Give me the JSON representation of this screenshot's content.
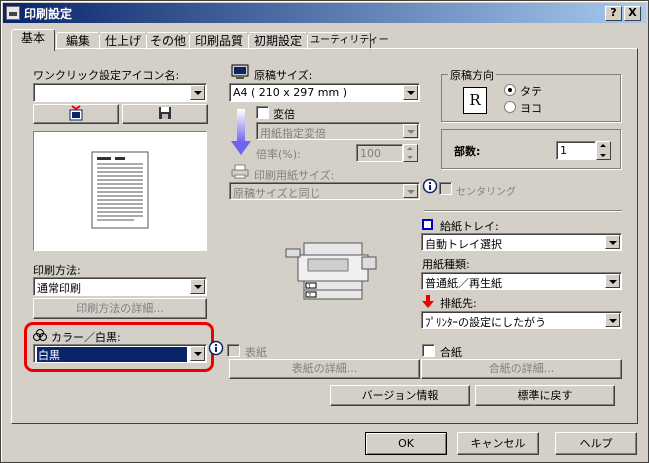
{
  "window": {
    "title": "印刷設定",
    "help_button": "?",
    "close_button": "X"
  },
  "tabs": [
    "基本",
    "編集",
    "仕上げ",
    "その他",
    "印刷品質",
    "初期設定",
    "ユーティリティー"
  ],
  "oneclick": {
    "label": "ワンクリック設定アイコン名:",
    "value": ""
  },
  "print_method": {
    "label": "印刷方法:",
    "value": "通常印刷",
    "details_button": "印刷方法の詳細..."
  },
  "color": {
    "label": "カラー／白黒:",
    "value": "白黒"
  },
  "original_size": {
    "label": "原稿サイズ:",
    "value": "A4 ( 210 x 297 mm )"
  },
  "scale": {
    "checkbox_label": "変倍",
    "paper_label": "用紙指定変倍",
    "ratio_label": "倍率(%):",
    "ratio_value": "100"
  },
  "print_paper_size": {
    "label": "印刷用紙サイズ:",
    "value": "原稿サイズと同じ"
  },
  "centering": {
    "label": "センタリング"
  },
  "orientation": {
    "title": "原稿方向",
    "portrait": "タテ",
    "landscape": "ヨコ",
    "icon_letter": "R",
    "selected": "portrait"
  },
  "copies": {
    "label": "部数:",
    "value": "1"
  },
  "tray": {
    "label": "給紙トレイ:",
    "value": "自動トレイ選択"
  },
  "paper_type": {
    "label": "用紙種類:",
    "value": "普通紙／再生紙"
  },
  "output": {
    "label": "排紙先:",
    "value": "ﾌﾟﾘﾝﾀｰの設定にしたがう"
  },
  "cover": {
    "label": "表紙",
    "details_button": "表紙の詳細..."
  },
  "slip": {
    "label": "合紙",
    "details_button": "合紙の詳細..."
  },
  "version_button": "バージョン情報",
  "default_button": "標準に戻す",
  "ok_button": "OK",
  "cancel_button": "キャンセル",
  "help_button": "ヘルプ",
  "colors": {
    "titlebar": "#0a246a",
    "highlight": "#e00000",
    "selection": "#0a246a"
  }
}
